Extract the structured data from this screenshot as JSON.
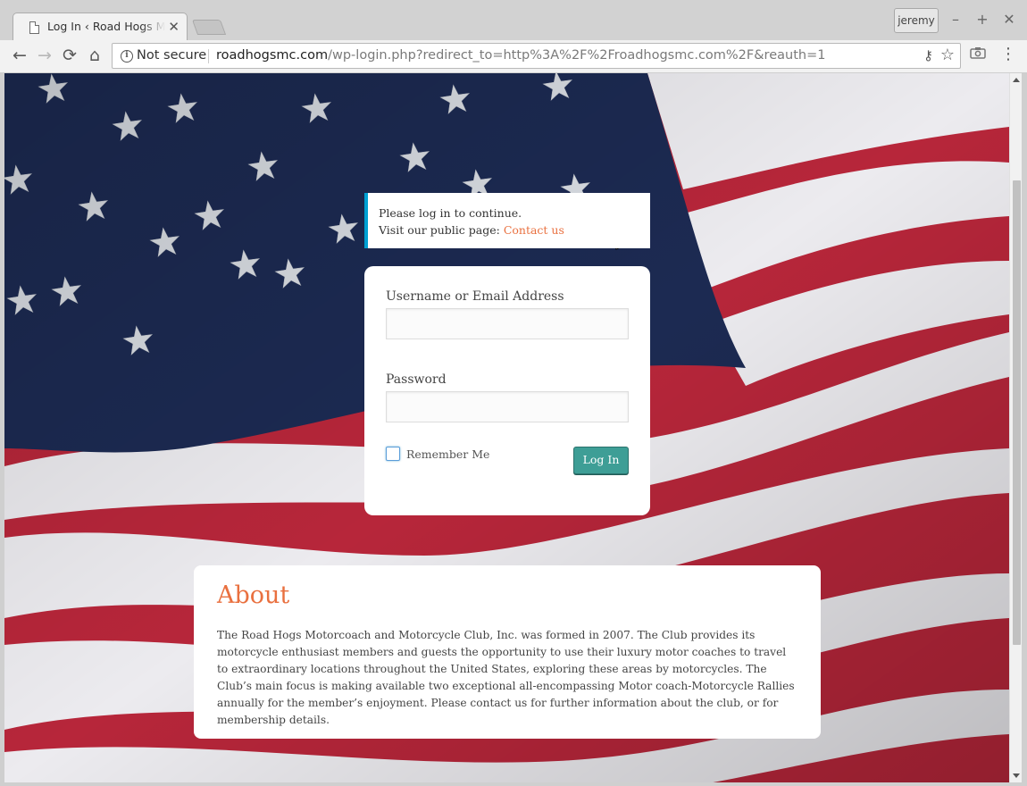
{
  "browser": {
    "tab_title": "Log In ‹ Road Hogs Mot",
    "tab_close": "✕",
    "profile_name": "jeremy",
    "window_controls": {
      "minimize": "–",
      "maximize": "+",
      "close": "✕"
    },
    "nav": {
      "back": "←",
      "forward": "→",
      "reload": "⟳",
      "home": "⌂"
    },
    "security_label": "Not secure",
    "url_host": "roadhogsmc.com",
    "url_path": "/wp-login.php?redirect_to=http%3A%2F%2Froadhogsmc.com%2F&reauth=1",
    "icons": [
      "info-icon",
      "key-icon",
      "star-icon",
      "camera-icon",
      "menu-icon"
    ]
  },
  "notice": {
    "line1": "Please log in to continue.",
    "line2_prefix": "Visit our public page: ",
    "link_text": "Contact us"
  },
  "login_form": {
    "username_label": "Username or Email Address",
    "username_value": "",
    "password_label": "Password",
    "password_value": "",
    "remember_label": "Remember Me",
    "remember_checked": false,
    "submit_label": "Log In"
  },
  "about": {
    "heading": "About",
    "body": "The Road Hogs Motorcoach and Motorcycle Club, Inc. was formed in 2007. The Club provides its motorcycle enthusiast members and guests the opportunity to use their luxury motor coaches to travel to extraordinary locations throughout the United States, exploring these areas by motorcycles. The Club’s main focus is making available two exceptional all-encompassing Motor coach-Motorcycle Rallies annually for the member’s enjoyment. Please contact us for further information about the club, or for membership details."
  },
  "colors": {
    "accent": "#e9703f",
    "notice_border": "#00a0d2",
    "button": "#3e9e96",
    "flag_blue": "#1c2a52",
    "flag_red": "#b7263a"
  }
}
